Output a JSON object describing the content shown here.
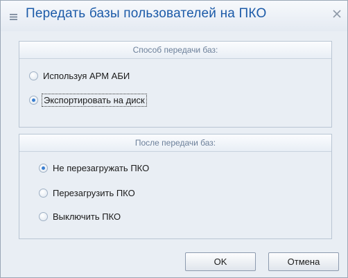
{
  "dialog": {
    "title": "Передать базы пользователей на ПКО",
    "menu_icon": "menu-icon",
    "close_icon": "close-icon"
  },
  "transfer_method": {
    "header": "Способ передачи баз:",
    "options": [
      {
        "label": "Используя АРМ АБИ",
        "selected": false
      },
      {
        "label": "Экспортировать на диск",
        "selected": true
      }
    ]
  },
  "after_transfer": {
    "header": "После передачи баз:",
    "options": [
      {
        "label": "Не перезагружать ПКО",
        "selected": true
      },
      {
        "label": "Перезагрузить ПКО",
        "selected": false
      },
      {
        "label": "Выключить ПКО",
        "selected": false
      }
    ]
  },
  "buttons": {
    "ok_label": "OK",
    "cancel_label": "Отмена"
  },
  "colors": {
    "title": "#1b5aa8",
    "group_header_text": "#6b7f99",
    "background": "#e9eef4",
    "radio_dot": "#3a7fd1"
  }
}
